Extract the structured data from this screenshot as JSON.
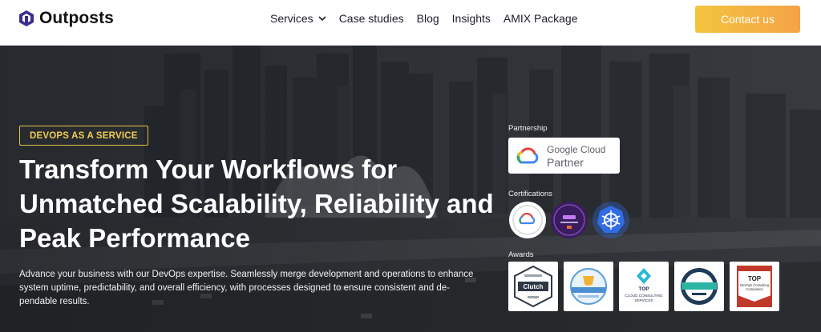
{
  "nav": {
    "logo_text": "Outposts",
    "links": [
      {
        "label": "Services"
      },
      {
        "label": "Case studies"
      },
      {
        "label": "Blog"
      },
      {
        "label": "Insights"
      },
      {
        "label": "AMIX Package"
      }
    ],
    "contact_label": "Contact us"
  },
  "hero": {
    "badge": "DEVOPS AS A SERVICE",
    "headline": "Transform Your Workflows for Unmatched Scalability, Reliability and Peak Performance",
    "subtext": "Advance your business with our DevOps expertise. Seamlessly merge development and operations to enhance system uptime, predictability, and overall efficiency, with processes designed to ensure consistent and de-pendable results."
  },
  "partnership": {
    "label": "Partnership",
    "card_line1": "Google Cloud",
    "card_line2": "Partner"
  },
  "certifications": {
    "label": "Certifications",
    "items": [
      {
        "icon": "google-cloud-certified-icon",
        "color": "#ffffff"
      },
      {
        "icon": "professional-certification-icon",
        "color": "#3a1c5e"
      },
      {
        "icon": "kubernetes-certified-icon",
        "color": "#326ce5"
      }
    ]
  },
  "awards": {
    "label": "Awards",
    "items": [
      {
        "icon": "clutch-award-icon"
      },
      {
        "icon": "top-rated-award-icon"
      },
      {
        "icon": "top-cloud-consulting-services-icon",
        "text": "TOP",
        "text2": "CLOUD CONSULTING",
        "text3": "SERVICES"
      },
      {
        "icon": "top-cloud-consulting-companies-icon"
      },
      {
        "icon": "top-devops-consulting-icon",
        "text": "TOP",
        "text2": "DevOps Consulting",
        "text3": "Companies"
      }
    ],
    "clutch_text": "Clutch"
  },
  "colors": {
    "accent_start": "#f4c53f",
    "accent_end": "#f5a247",
    "badge": "#e9c347"
  }
}
